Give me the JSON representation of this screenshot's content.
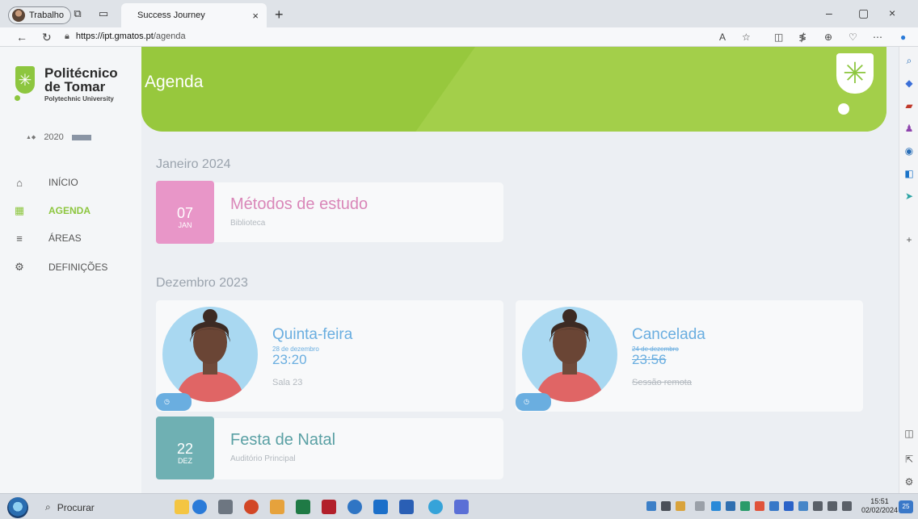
{
  "browser": {
    "profile_label": "Trabalho",
    "tab_title": "Success Journey",
    "tab_close": "×",
    "new_tab": "+",
    "url_host": "https://ipt.gmatos.pt",
    "url_path": "/agenda",
    "window_controls": {
      "minimize": "–",
      "restore": "▢",
      "close": "×"
    }
  },
  "sidebar": {
    "logo_line1": "Politécnico",
    "logo_line2": "de Tomar",
    "logo_line3": "Polytechnic University",
    "partners_2020": "2020",
    "items": [
      {
        "label": "INÍCIO",
        "icon": "home-icon",
        "active": false
      },
      {
        "label": "AGENDA",
        "icon": "calendar-icon",
        "active": true
      },
      {
        "label": "ÁREAS",
        "icon": "menu-icon",
        "active": false
      },
      {
        "label": "DEFINIÇÕES",
        "icon": "gear-icon",
        "active": false
      }
    ]
  },
  "main": {
    "page_title": "Agenda",
    "sections": [
      {
        "month": "Janeiro 2024",
        "events": [
          {
            "day": "07",
            "month_abbr": "JAN",
            "title": "Métodos de estudo",
            "location": "Biblioteca",
            "color": "#e896c8"
          }
        ]
      },
      {
        "month": "Dezembro 2023",
        "appointments": [
          {
            "title": "Quinta-feira",
            "date": "28 de dezembro",
            "time": "23:20",
            "room": "Sala 23",
            "cancelled": false
          },
          {
            "title": "Cancelada",
            "date": "24 de dezembro",
            "time": "23:56",
            "room": "Sessão remota",
            "cancelled": true
          }
        ],
        "events": [
          {
            "day": "22",
            "month_abbr": "DEZ",
            "title": "Festa de Natal",
            "location": "Auditório Principal",
            "color": "#6fb0b3"
          }
        ]
      }
    ]
  },
  "taskbar": {
    "search_placeholder": "Procurar",
    "time": "15:51",
    "date": "02/02/2024",
    "notification_count": "25"
  },
  "colors": {
    "brand_green": "#8dc63f",
    "header_green": "#97c83d",
    "appointment_blue": "#6aaee0"
  }
}
